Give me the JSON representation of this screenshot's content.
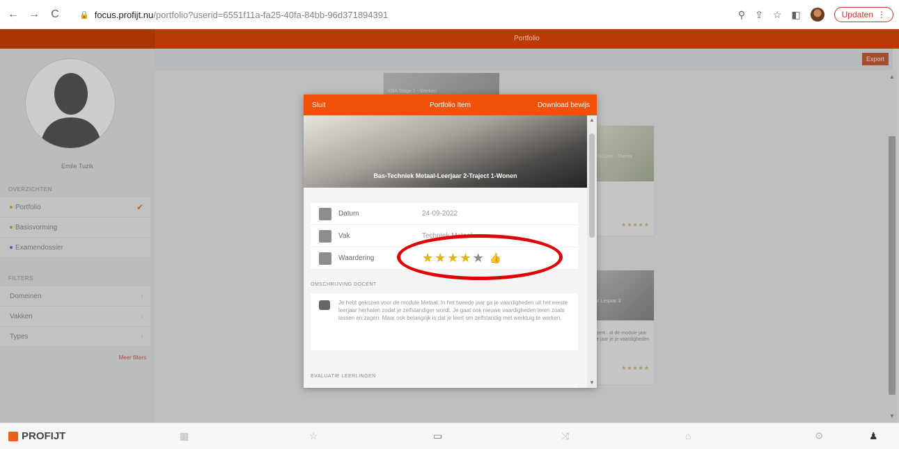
{
  "browser": {
    "url_host": "focus.profijt.nu",
    "url_path": "/portfolio?userid=6551f11a-fa25-40fa-84bb-96d371894391",
    "update_label": "Updaten"
  },
  "appbar": {
    "title": "Portfolio"
  },
  "sidebar": {
    "username": "Emile Tuzik",
    "section_overviews": "OVERZICHTEN",
    "items": [
      {
        "label": "Portfolio",
        "dot_color": "#d9a01a"
      },
      {
        "label": "Basisvorming",
        "dot_color": "#9ab01a"
      },
      {
        "label": "Examendossier",
        "dot_color": "#2a5fd0"
      }
    ],
    "section_filters": "FILTERS",
    "filters": [
      {
        "label": "Domeinen"
      },
      {
        "label": "Vakken"
      },
      {
        "label": "Types"
      }
    ],
    "show_more": "Meer filters"
  },
  "main": {
    "export_label": "Export",
    "card_top_caption": "KBA Stage 1 - Werken",
    "card_right_caption": "Studio Les - Thema",
    "card_right2_caption": "Jaar Lesjaar 3",
    "card_right2_text": "Jij bent...al de module jaar je je jaar je je vaardigheden"
  },
  "modal": {
    "close_label": "Sluit",
    "title": "Portfolio Item",
    "download_label": "Download bewijs",
    "hero_title": "Bas-Techniek Metaal-Leerjaar 2-Traject 1-Wonen",
    "rows": [
      {
        "label": "Datum",
        "value": "24-09-2022"
      },
      {
        "label": "Vak",
        "value": "Techniek Metaal"
      },
      {
        "label": "Waardering",
        "value": ""
      }
    ],
    "rating": {
      "value": 4,
      "max": 5
    },
    "section_docent": "OMSCHRIJVING DOCENT",
    "docent_text": "Je hebt gekozen voor de module Metaal. In het tweede jaar ga je vaardigheden uit het eerste leerjaar herhalen zodat je zelfstandiger wordt. Je gaat ook nieuwe vaardigheden leren zoals lassen en zagen. Maar ook belangrijk is dat je leert om zelfstandig met werktuig te werken.",
    "section_eval": "EVALUATIE LEERLINGEN"
  },
  "bottombar": {
    "logo_text": "PROFIJT"
  }
}
